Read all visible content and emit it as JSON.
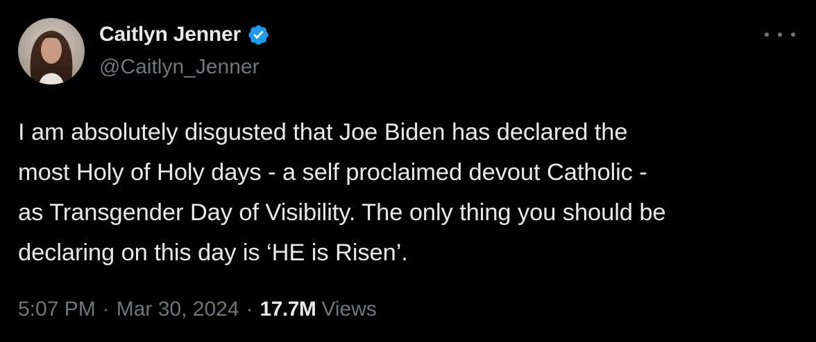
{
  "tweet": {
    "display_name": "Caitlyn Jenner",
    "handle": "@Caitlyn_Jenner",
    "verified_icon": "verified-badge-icon",
    "more_icon": "more-options-icon",
    "text": "I am absolutely disgusted that Joe Biden has declared the\nmost Holy of Holy days - a self proclaimed devout Catholic -\nas Transgender Day of Visibility. The only thing you should be\ndeclaring on this day is ‘HE is Risen’.",
    "time": "5:07 PM",
    "separator": "·",
    "date": "Mar 30, 2024",
    "views_count": "17.7M",
    "views_label": "Views"
  },
  "colors": {
    "background": "#000000",
    "primary_text": "#e7e9ea",
    "secondary_text": "#71767b",
    "verified_blue": "#1d9bf0"
  }
}
